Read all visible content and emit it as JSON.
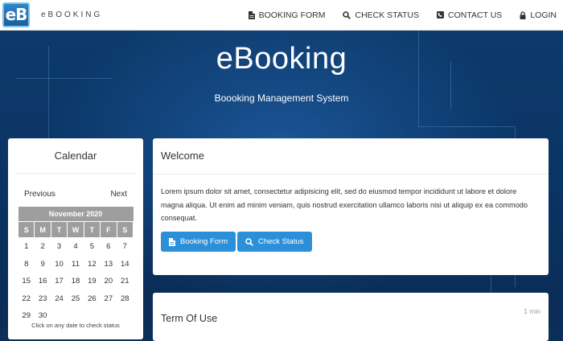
{
  "navbar": {
    "logo_text": "eB",
    "brand": "eBOOKING",
    "links": [
      {
        "label": "BOOKING FORM",
        "icon": "file-icon"
      },
      {
        "label": "CHECK STATUS",
        "icon": "search-icon"
      },
      {
        "label": "CONTACT US",
        "icon": "phone-icon"
      },
      {
        "label": "LOGIN",
        "icon": "lock-icon"
      }
    ]
  },
  "hero": {
    "title": "eBooking",
    "subtitle": "Boooking Management System"
  },
  "calendar": {
    "title": "Calendar",
    "prev_label": "Previous",
    "next_label": "Next",
    "month": "November 2020",
    "weekdays": [
      "S",
      "M",
      "T",
      "W",
      "T",
      "F",
      "S"
    ],
    "weeks": [
      [
        "1",
        "2",
        "3",
        "4",
        "5",
        "6",
        "7"
      ],
      [
        "8",
        "9",
        "10",
        "11",
        "12",
        "13",
        "14"
      ],
      [
        "15",
        "16",
        "17",
        "18",
        "19",
        "20",
        "21"
      ],
      [
        "22",
        "23",
        "24",
        "25",
        "26",
        "27",
        "28"
      ],
      [
        "29",
        "30",
        "",
        "",
        "",
        "",
        ""
      ]
    ],
    "hint": "Click on any date to check status"
  },
  "welcome": {
    "title": "Welcome",
    "body": "Lorem ipsum dolor sit amet, consectetur adipisicing elit, sed do eiusmod tempor incididunt ut labore et dolore magna aliqua. Ut enim ad minim veniam, quis nostrud exercitation ullamco laboris nisi ut aliquip ex ea commodo consequat.",
    "booking_button": "Booking Form",
    "status_button": "Check Status"
  },
  "terms": {
    "title": "Term Of Use",
    "read_time": "1 min"
  },
  "colors": {
    "accent": "#2b90d9",
    "calendar_header": "#9e9e9e",
    "hero_bg": "#0b3566"
  }
}
